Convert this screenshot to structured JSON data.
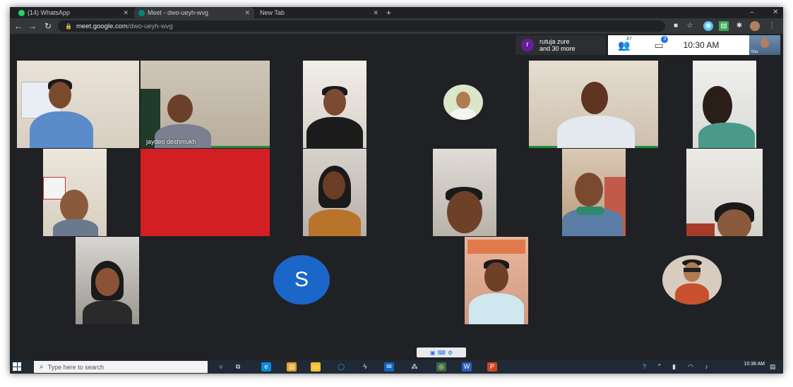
{
  "browser": {
    "tabs": [
      {
        "title": "(14) WhatsApp",
        "icon": "whatsapp-icon"
      },
      {
        "title": "Meet - dwo-ueyh-wvg",
        "icon": "meet-icon"
      },
      {
        "title": "New Tab",
        "icon": "newtab-icon"
      }
    ],
    "url_host": "meet.google.com",
    "url_path": "/dwo-ueyh-wvg"
  },
  "meet": {
    "presenter_initial": "r",
    "presenter_name": "rutuja zure",
    "presenter_more": "and 30 more",
    "participant_count": "47",
    "chat_count": "3",
    "time": "10:30 AM",
    "self_label": "You",
    "speaker_name": "jaydeo deshmukh",
    "s_avatar_letter": "S"
  },
  "taskbar": {
    "search_placeholder": "Type here to search",
    "time": "10:38 AM"
  },
  "colors": {
    "meet_background": "#202124",
    "speaking_indicator": "#1e8e3e",
    "avatar_blue": "#1b66c9"
  }
}
